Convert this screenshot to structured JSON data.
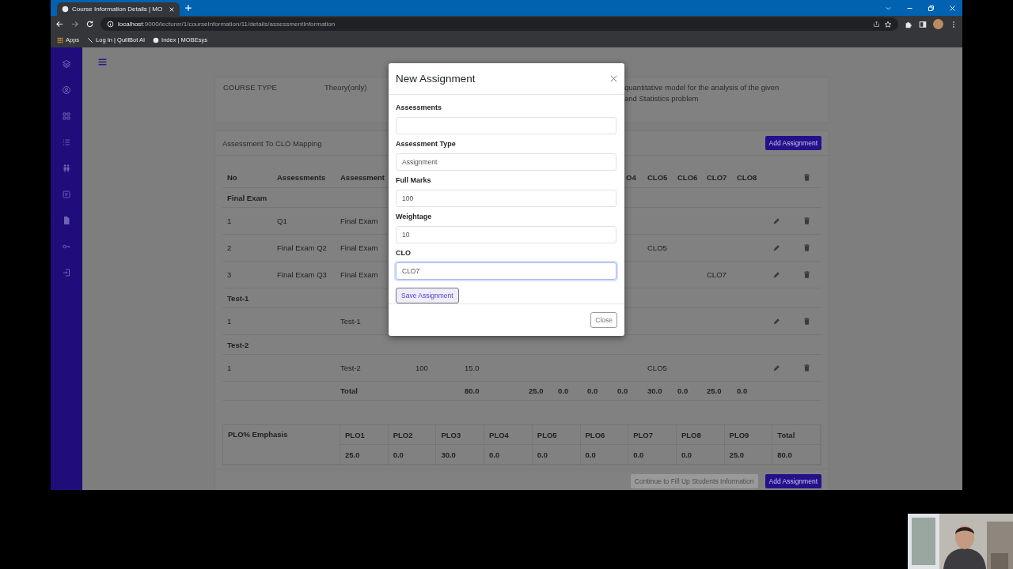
{
  "browser": {
    "tab_title": "Course Information Details | MO",
    "url_host": "localhost",
    "url_path": ":9000/lecturer/1/courseInformation/11/details/assessmentInformation",
    "bookmarks": [
      "Apps",
      "Log In | QuillBot AI",
      "Index | MOBEsys"
    ]
  },
  "course_info": {
    "label": "COURSE TYPE",
    "value": "Theory(only)",
    "description_lines": [
      "quantitative model for the analysis of the given",
      "and Statistics problem"
    ]
  },
  "mapping": {
    "title": "Assessment To CLO Mapping",
    "add_button": "Add Assignment",
    "header_left": [
      "No",
      "Assessments",
      "Assessment"
    ],
    "header_right": [
      "O4",
      "CLO5",
      "CLO6",
      "CLO7",
      "CLO8"
    ],
    "rows": [
      {
        "kind": "group",
        "label": "Final Exam"
      },
      {
        "kind": "item",
        "cells": [
          "1",
          "Q1",
          "Final Exam",
          null,
          null,
          null,
          null,
          null,
          null,
          null,
          null,
          null,
          null
        ]
      },
      {
        "kind": "item",
        "cells": [
          "2",
          "Final Exam Q2",
          "Final Exam",
          null,
          null,
          null,
          null,
          null,
          null,
          "CLO5",
          null,
          null,
          null
        ]
      },
      {
        "kind": "item",
        "cells": [
          "3",
          "Final Exam Q3",
          "Final Exam",
          null,
          null,
          null,
          null,
          null,
          null,
          null,
          null,
          "CLO7",
          null
        ]
      },
      {
        "kind": "group",
        "label": "Test-1"
      },
      {
        "kind": "item",
        "cells": [
          "1",
          null,
          "Test-1",
          null,
          null,
          null,
          null,
          null,
          null,
          null,
          null,
          null,
          null
        ]
      },
      {
        "kind": "group",
        "label": "Test-2"
      },
      {
        "kind": "item",
        "cells": [
          "1",
          null,
          "Test-2",
          "100",
          "15.0",
          null,
          null,
          null,
          null,
          "CLO5",
          null,
          null,
          null
        ]
      },
      {
        "kind": "total",
        "cells": [
          null,
          null,
          "Total",
          null,
          "80.0",
          "25.0",
          "0.0",
          "0.0",
          "0.0",
          "30.0",
          "0.0",
          "25.0",
          "0.0"
        ]
      }
    ],
    "plo": {
      "title": "PLO% Emphasis",
      "headers": [
        "PLO1",
        "PLO2",
        "PLO3",
        "PLO4",
        "PLO5",
        "PLO6",
        "PLO7",
        "PLO8",
        "PLO9",
        "Total"
      ],
      "values": [
        "25.0",
        "0.0",
        "30.0",
        "0.0",
        "0.0",
        "0.0",
        "0.0",
        "0.0",
        "25.0",
        "80.0"
      ]
    },
    "footer_buttons": [
      {
        "label": "Continue to Fill Up Students Information",
        "disabled": true
      },
      {
        "label": "Add Assignment",
        "disabled": false
      }
    ]
  },
  "modal": {
    "title": "New Assignment",
    "fields": [
      {
        "label": "Assessments",
        "focused": false
      },
      {
        "label": "Assessment Type",
        "value": "Assignment",
        "focused": false
      },
      {
        "label": "Full Marks",
        "value": "100",
        "focused": false
      },
      {
        "label": "Weightage",
        "value": "10",
        "focused": false
      },
      {
        "label": "CLO",
        "value": "CLO7",
        "focused": true
      }
    ],
    "save_button": "Save Assignment",
    "close_button": "Close"
  }
}
